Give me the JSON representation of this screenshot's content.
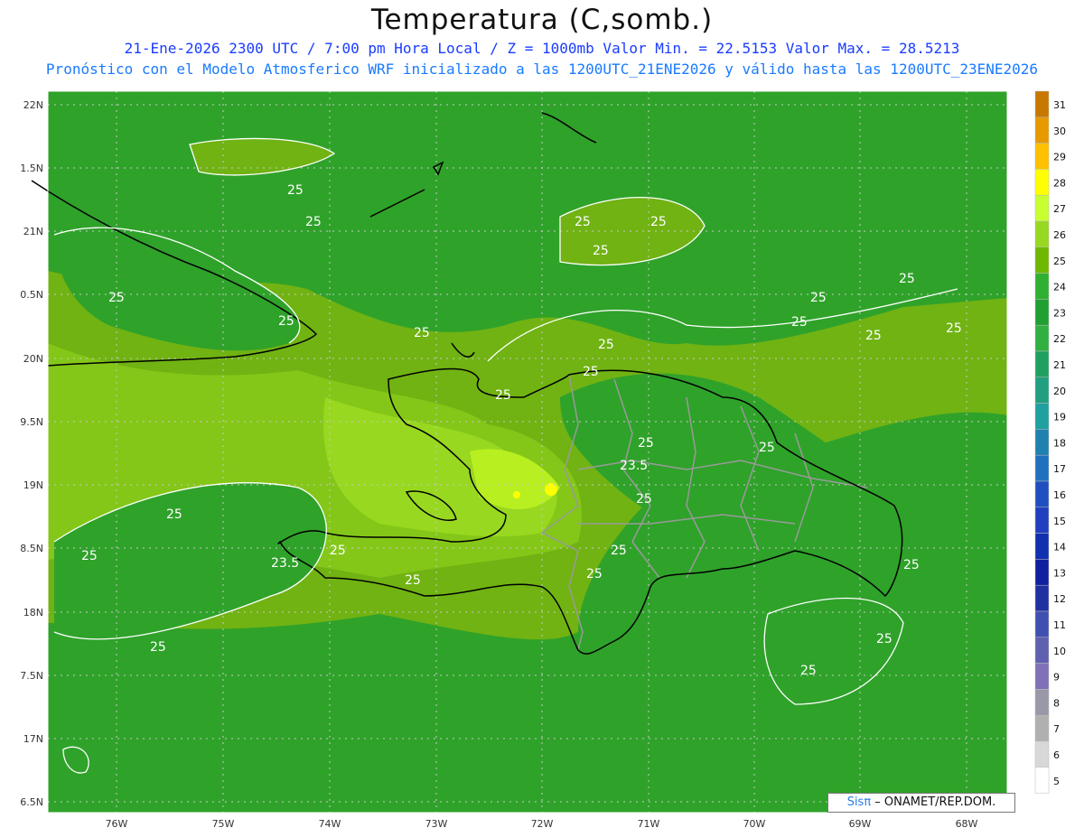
{
  "header": {
    "title": "Temperatura (C,somb.)",
    "line1": "21-Ene-2026  2300 UTC / 7:00 pm Hora Local / Z = 1000mb   Valor Min. = 22.5153  Valor Max. = 28.5213",
    "line2": "Pronóstico con el Modelo Atmosferico WRF inicializado a las 1200UTC_21ENE2026 y válido hasta las  1200UTC_23ENE2026"
  },
  "axes": {
    "lat_labels": [
      "22N",
      "1.5N",
      "21N",
      "0.5N",
      "20N",
      "9.5N",
      "19N",
      "8.5N",
      "18N",
      "7.5N",
      "17N",
      "6.5N"
    ],
    "lon_labels": [
      "76W",
      "75W",
      "74W",
      "73W",
      "72W",
      "71W",
      "70W",
      "69W",
      "68W"
    ]
  },
  "contour_labels": [
    "25",
    "25",
    "25",
    "25",
    "25",
    "25",
    "25",
    "25",
    "25",
    "25",
    "25",
    "25",
    "25",
    "25",
    "25",
    "25",
    "25",
    "25",
    "25",
    "25",
    "23.5",
    "25",
    "25",
    "25",
    "25",
    "25",
    "25",
    "23.5",
    "25",
    "25",
    "25",
    "25",
    "25",
    "25"
  ],
  "colorbar": {
    "labels": [
      "31",
      "30",
      "29",
      "28",
      "27",
      "26",
      "25",
      "24",
      "23",
      "22",
      "21",
      "20",
      "19",
      "18",
      "17",
      "16",
      "15",
      "14",
      "13",
      "12",
      "11",
      "10",
      "9",
      "8",
      "7",
      "6",
      "5"
    ],
    "colors": [
      "#c87800",
      "#e69a00",
      "#ffc000",
      "#ffff00",
      "#c8ff30",
      "#98d820",
      "#6fb800",
      "#30b030",
      "#20a030",
      "#30b040",
      "#20a060",
      "#20a080",
      "#20a0a0",
      "#2080b0",
      "#2070c0",
      "#2050c0",
      "#2040c0",
      "#1030b0",
      "#1020a0",
      "#2030a0",
      "#4050b0",
      "#6060b0",
      "#8070b8",
      "#9898a8",
      "#b0b0b0",
      "#d8d8d8",
      "#ffffff"
    ]
  },
  "credit": {
    "logo": "Sisπ",
    "text": " – ONAMET/REP.DOM."
  },
  "colors": {
    "background_field": "#2fa22a",
    "warm_field": "#70b313",
    "warmer_field": "#98d820",
    "hot_spot": "#d8ff40",
    "coast": "#000000",
    "borders": "#9a9a9a",
    "contour": "#ffffff"
  }
}
